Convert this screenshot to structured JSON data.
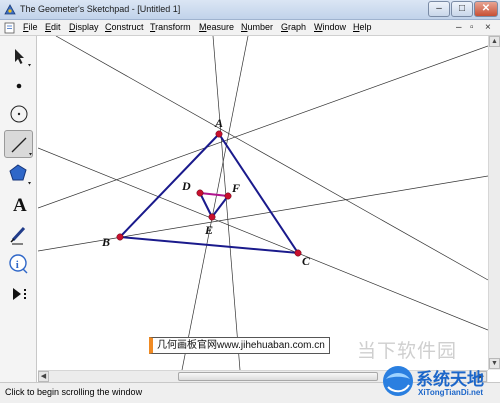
{
  "window": {
    "title": "The Geometer's Sketchpad - [Untitled 1]",
    "minimize": "–",
    "maximize": "□",
    "close": "✕"
  },
  "menus": [
    "File",
    "Edit",
    "Display",
    "Construct",
    "Transform",
    "Measure",
    "Number",
    "Graph",
    "Window",
    "Help"
  ],
  "doc_controls": {
    "minimize": "–",
    "restore": "▫",
    "close": "×"
  },
  "tools": [
    "arrow-select-tool",
    "point-tool",
    "compass-tool",
    "straightedge-tool",
    "polygon-tool",
    "text-tool",
    "marker-tool",
    "information-tool",
    "custom-tool"
  ],
  "selected_tool": "straightedge-tool",
  "tool_glyphs": {
    "text": "A"
  },
  "figure": {
    "points": [
      "A",
      "B",
      "C",
      "D",
      "E",
      "F"
    ],
    "triangle_color": "#1a1a8c",
    "inner_segment_color": "#b0168e",
    "point_color": "#c8102e"
  },
  "status": {
    "text": "Click to begin scrolling the window"
  },
  "watermarks": {
    "site": "几何画板官网www.jihehuaban.com.cn",
    "brand_cn": "当下软件园",
    "brand2_cn": "系统天地",
    "brand2_url": "XiTongTianDi.net"
  }
}
